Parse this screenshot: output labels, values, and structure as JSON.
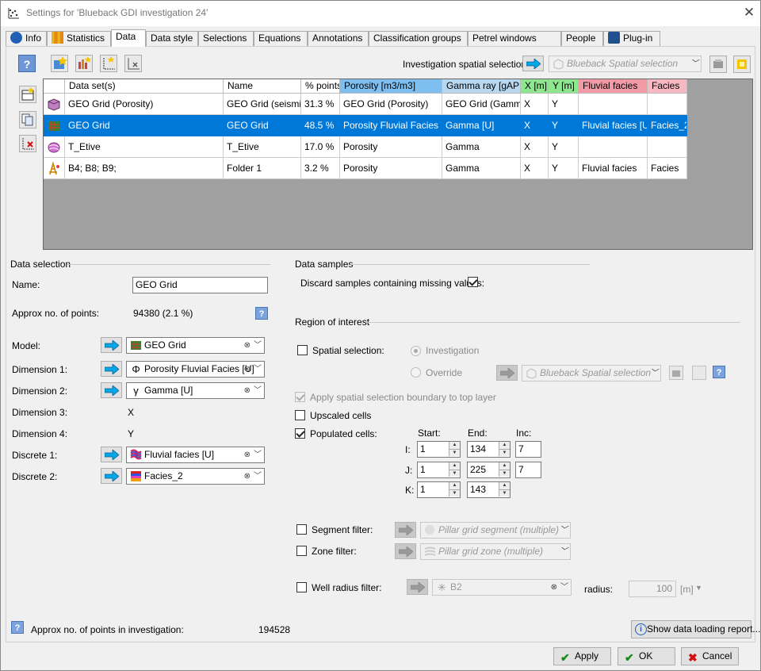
{
  "window": {
    "title": "Settings for 'Blueback GDI investigation 24'"
  },
  "tabs": [
    {
      "label": "Info"
    },
    {
      "label": "Statistics"
    },
    {
      "label": "Data"
    },
    {
      "label": "Data style"
    },
    {
      "label": "Selections"
    },
    {
      "label": "Equations"
    },
    {
      "label": "Annotations"
    },
    {
      "label": "Classification groups"
    },
    {
      "label": "Petrel windows style"
    },
    {
      "label": "People"
    },
    {
      "label": "Plug-in"
    }
  ],
  "spatial": {
    "label": "Investigation spatial selection:",
    "value": "Blueback Spatial selection"
  },
  "grid": {
    "columns": [
      "Data set(s)",
      "Name",
      "% points",
      "Porosity [m3/m3]",
      "Gamma ray [gAPI]",
      "X [m]",
      "Y [m]",
      "Fluvial facies",
      "Facies"
    ],
    "header_colors": {
      "porosity": "#7fbff0",
      "gamma": "#b7d8f0",
      "xy": "#8ee68e",
      "fluvial": "#f29aa6",
      "facies": "#f7b8c2"
    },
    "rows": [
      {
        "dataset": "GEO Grid (Porosity)",
        "name": "GEO Grid (seismic)",
        "points": "31.3 %",
        "porosity": "GEO Grid (Porosity)",
        "gamma": "GEO Grid (Gamma)",
        "x": "X",
        "y": "Y",
        "fluvial": "",
        "facies": ""
      },
      {
        "dataset": "GEO Grid",
        "name": "GEO Grid",
        "points": "48.5 %",
        "porosity": "Porosity Fluvial Facies [U]",
        "gamma": "Gamma [U]",
        "x": "X",
        "y": "Y",
        "fluvial": "Fluvial facies [U]",
        "facies": "Facies_2"
      },
      {
        "dataset": "T_Etive",
        "name": "T_Etive",
        "points": "17.0 %",
        "porosity": "Porosity",
        "gamma": "Gamma",
        "x": "X",
        "y": "Y",
        "fluvial": "",
        "facies": ""
      },
      {
        "dataset": "B4; B8; B9;",
        "name": "Folder 1",
        "points": "3.2 %",
        "porosity": "Porosity",
        "gamma": "Gamma",
        "x": "X",
        "y": "Y",
        "fluvial": "Fluvial facies",
        "facies": "Facies"
      }
    ],
    "selected_row": 1
  },
  "data_selection": {
    "header": "Data selection",
    "name_label": "Name:",
    "name_value": "GEO Grid",
    "approx_label": "Approx no. of points:",
    "approx_value": "94380 (2.1 %)",
    "model_label": "Model:",
    "model_value": "GEO Grid",
    "dim1_label": "Dimension 1:",
    "dim1_value": "Porosity Fluvial Facies [U]",
    "dim2_label": "Dimension 2:",
    "dim2_value": "Gamma [U]",
    "dim3_label": "Dimension 3:",
    "dim3_value": "X",
    "dim4_label": "Dimension 4:",
    "dim4_value": "Y",
    "disc1_label": "Discrete 1:",
    "disc1_value": "Fluvial facies [U]",
    "disc2_label": "Discrete 2:",
    "disc2_value": "Facies_2"
  },
  "data_samples": {
    "header": "Data samples",
    "discard_label": "Discard samples containing missing values:",
    "discard_checked": true
  },
  "roi": {
    "header": "Region of interest",
    "spatial_label": "Spatial selection:",
    "investigation_label": "Investigation",
    "override_label": "Override",
    "override_value": "Blueback Spatial selection",
    "apply_boundary_label": "Apply spatial selection boundary to top layer",
    "upscaled_label": "Upscaled cells",
    "populated_label": "Populated cells:",
    "start_label": "Start:",
    "end_label": "End:",
    "inc_label": "Inc:",
    "i_label": "I:",
    "j_label": "J:",
    "k_label": "K:",
    "i": {
      "start": "1",
      "end": "134",
      "inc": "7"
    },
    "j": {
      "start": "1",
      "end": "225",
      "inc": "7"
    },
    "k": {
      "start": "1",
      "end": "143"
    },
    "segment_label": "Segment filter:",
    "segment_value": "Pillar grid segment (multiple)",
    "zone_label": "Zone filter:",
    "zone_value": "Pillar grid zone (multiple)",
    "well_label": "Well radius filter:",
    "well_value": "B2",
    "radius_label": "radius:",
    "radius_value": "100",
    "radius_unit": "[m]"
  },
  "footer": {
    "approx_label": "Approx no. of points in investigation:",
    "approx_value": "194528",
    "report_button": "Show data loading report..."
  },
  "buttons": {
    "apply": "Apply",
    "ok": "OK",
    "cancel": "Cancel"
  }
}
